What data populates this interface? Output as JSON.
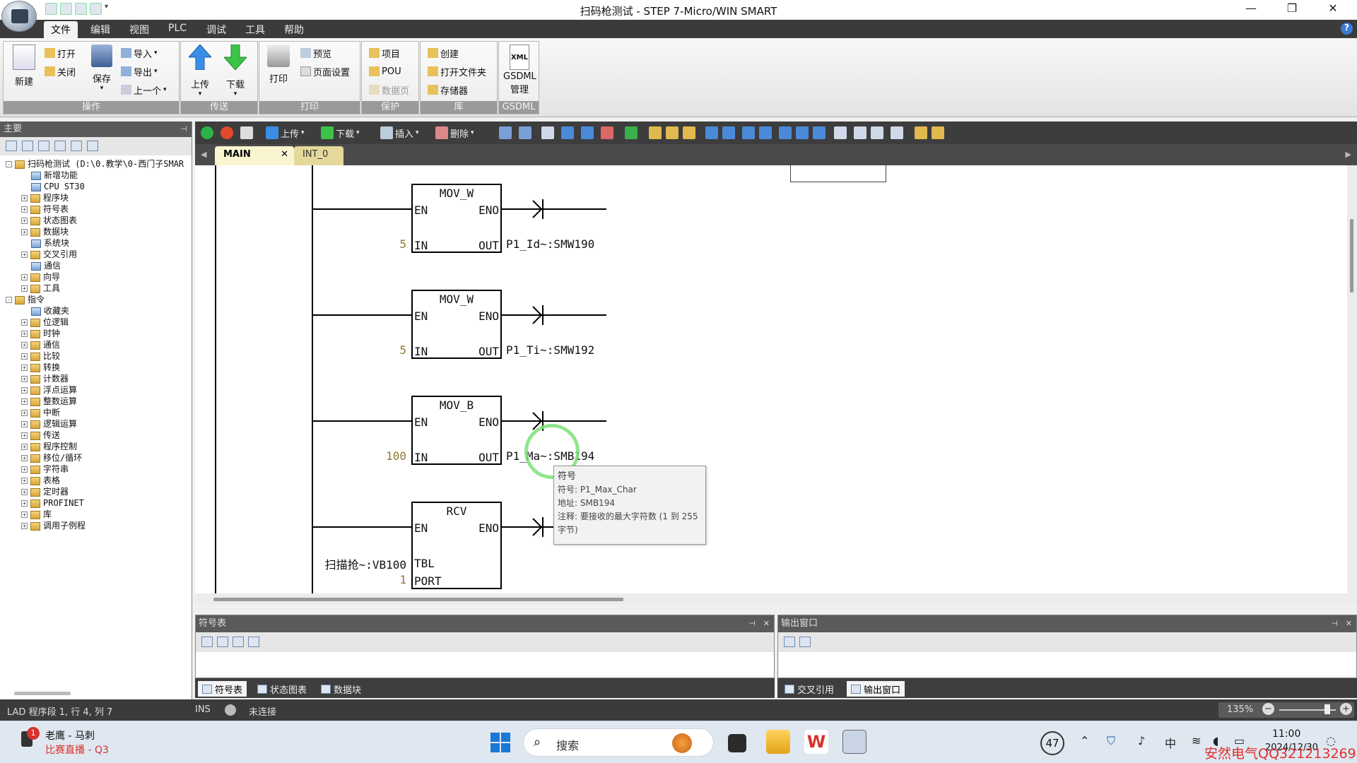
{
  "window": {
    "title": "扫码枪测试 - STEP 7-Micro/WIN SMART",
    "minimize": "—",
    "restore": "❐",
    "close": "✕"
  },
  "menu": {
    "items": [
      "文件",
      "编辑",
      "视图",
      "PLC",
      "调试",
      "工具",
      "帮助"
    ],
    "help": "?"
  },
  "ribbon": {
    "groups": {
      "operation": "操作",
      "transfer": "传送",
      "print": "打印",
      "protect": "保护",
      "library": "库",
      "gsdml": "GSDML"
    },
    "new": "新建",
    "open": "打开",
    "close": "关闭",
    "save": "保存",
    "import": "导入",
    "export": "导出",
    "previous": "上一个",
    "upload": "上传",
    "download": "下载",
    "print": "打印",
    "preview": "预览",
    "page_setup": "页面设置",
    "project": "项目",
    "pou": "POU",
    "data_page": "数据页",
    "create": "创建",
    "open_folder": "打开文件夹",
    "memory": "存储器",
    "gsdml_label": "GSDML",
    "gsdml_manage": "管理",
    "gsdml_xml": "XML"
  },
  "left_panel": {
    "title": "主要",
    "tree": [
      {
        "label": "扫码枪测试 (D:\\0.教学\\0-西门子SMAR",
        "indent": 0,
        "exp": "-"
      },
      {
        "label": "新增功能",
        "indent": 2,
        "exp": ""
      },
      {
        "label": "CPU ST30",
        "indent": 2,
        "exp": ""
      },
      {
        "label": "程序块",
        "indent": 1,
        "exp": "+"
      },
      {
        "label": "符号表",
        "indent": 1,
        "exp": "+"
      },
      {
        "label": "状态图表",
        "indent": 1,
        "exp": "+"
      },
      {
        "label": "数据块",
        "indent": 1,
        "exp": "+"
      },
      {
        "label": "系统块",
        "indent": 2,
        "exp": ""
      },
      {
        "label": "交叉引用",
        "indent": 1,
        "exp": "+"
      },
      {
        "label": "通信",
        "indent": 2,
        "exp": ""
      },
      {
        "label": "向导",
        "indent": 1,
        "exp": "+"
      },
      {
        "label": "工具",
        "indent": 1,
        "exp": "+"
      },
      {
        "label": "指令",
        "indent": 0,
        "exp": "-"
      },
      {
        "label": "收藏夹",
        "indent": 2,
        "exp": ""
      },
      {
        "label": "位逻辑",
        "indent": 1,
        "exp": "+"
      },
      {
        "label": "时钟",
        "indent": 1,
        "exp": "+"
      },
      {
        "label": "通信",
        "indent": 1,
        "exp": "+"
      },
      {
        "label": "比较",
        "indent": 1,
        "exp": "+"
      },
      {
        "label": "转换",
        "indent": 1,
        "exp": "+"
      },
      {
        "label": "计数器",
        "indent": 1,
        "exp": "+"
      },
      {
        "label": "浮点运算",
        "indent": 1,
        "exp": "+"
      },
      {
        "label": "整数运算",
        "indent": 1,
        "exp": "+"
      },
      {
        "label": "中断",
        "indent": 1,
        "exp": "+"
      },
      {
        "label": "逻辑运算",
        "indent": 1,
        "exp": "+"
      },
      {
        "label": "传送",
        "indent": 1,
        "exp": "+"
      },
      {
        "label": "程序控制",
        "indent": 1,
        "exp": "+"
      },
      {
        "label": "移位/循环",
        "indent": 1,
        "exp": "+"
      },
      {
        "label": "字符串",
        "indent": 1,
        "exp": "+"
      },
      {
        "label": "表格",
        "indent": 1,
        "exp": "+"
      },
      {
        "label": "定时器",
        "indent": 1,
        "exp": "+"
      },
      {
        "label": "PROFINET",
        "indent": 1,
        "exp": "+"
      },
      {
        "label": "库",
        "indent": 1,
        "exp": "+"
      },
      {
        "label": "调用子例程",
        "indent": 1,
        "exp": "+"
      }
    ]
  },
  "toolbar": {
    "upload": "上传",
    "download": "下载",
    "insert": "插入",
    "delete": "删除"
  },
  "tabs": {
    "main": "MAIN",
    "int0": "INT_0",
    "close": "✕",
    "left": "◀",
    "right": "▶"
  },
  "ladder": {
    "blocks": [
      {
        "name": "MOV_W",
        "en": "EN",
        "eno": "ENO",
        "in_label": "IN",
        "out_label": "OUT",
        "in_value": "5",
        "out_value": "P1_Id~:SMW190"
      },
      {
        "name": "MOV_W",
        "en": "EN",
        "eno": "ENO",
        "in_label": "IN",
        "out_label": "OUT",
        "in_value": "5",
        "out_value": "P1_Ti~:SMW192"
      },
      {
        "name": "MOV_B",
        "en": "EN",
        "eno": "ENO",
        "in_label": "IN",
        "out_label": "OUT",
        "in_value": "100",
        "out_value": "P1_Ma~:SMB194"
      }
    ],
    "rcv": {
      "name": "RCV",
      "en": "EN",
      "eno": "ENO",
      "tbl": "TBL",
      "port": "PORT",
      "tbl_value": "扫描抢~:VB100",
      "port_value": "1"
    }
  },
  "tooltip": {
    "title": "符号",
    "symbol": "符号: P1_Max_Char",
    "address": "地址: SMB194",
    "comment": "注释: 要接收的最大字符数 (1 到 255 字节)"
  },
  "symbol_panel": {
    "title": "符号表",
    "tabs": [
      "符号表",
      "状态图表",
      "数据块"
    ]
  },
  "output_panel": {
    "title": "输出窗口",
    "tabs": [
      "交叉引用",
      "输出窗口"
    ]
  },
  "status": {
    "position": "LAD 程序段 1, 行 4, 列 7",
    "mode": "INS",
    "connection": "未连接",
    "zoom": "135%"
  },
  "taskbar": {
    "notice_badge": "1",
    "notice_title": "老鹰 - 马刺",
    "notice_sub": "比赛直播 - Q3",
    "search": "搜索",
    "temp": "47",
    "ime": "中",
    "time": "11:00",
    "date": "2024/12/30"
  },
  "watermark": "安然电气QQ321213269"
}
